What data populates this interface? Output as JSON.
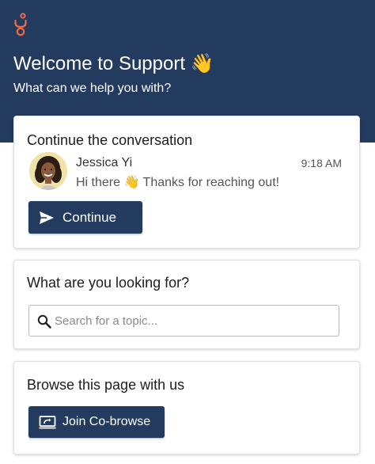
{
  "brand": {
    "logo_icon": "genesys-logo-icon",
    "accent_color": "#F26B43"
  },
  "header": {
    "title": "Welcome to Support 👋",
    "subtitle": "What can we help you with?",
    "background_color": "#233B5F"
  },
  "conversation": {
    "title": "Continue the conversation",
    "agent_name": "Jessica Yi",
    "time": "9:18 AM",
    "preview": "Hi there 👋 Thanks for reaching out!",
    "continue_label": "Continue",
    "continue_icon": "send-icon",
    "avatar_icon": "agent-avatar"
  },
  "search": {
    "title": "What are you looking for?",
    "placeholder": "Search for a topic...",
    "value": "",
    "icon": "search-icon"
  },
  "cobrowse": {
    "title": "Browse this page with us",
    "button_label": "Join Co-browse",
    "button_icon": "screen-share-icon"
  }
}
